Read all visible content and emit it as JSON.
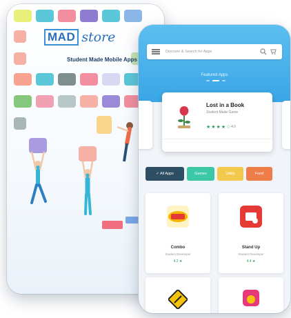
{
  "left_screen": {
    "logo_box": "MAD",
    "logo_script": "store",
    "tagline": "Student Made Mobile Apps"
  },
  "right_screen": {
    "search_placeholder": "Discover & Search for Apps",
    "header_title": "Featured Apps",
    "featured": {
      "title": "Lost in a Book",
      "subtitle": "Student Made Game",
      "stars": "★★★★☆",
      "rating": "4.0"
    },
    "filter_chips": [
      {
        "label": "✓ All Apps",
        "color": "#2e4f63"
      },
      {
        "label": "Games",
        "color": "#3cc8a6"
      },
      {
        "label": "Utility",
        "color": "#f2c94c"
      },
      {
        "label": "Food",
        "color": "#ef7d4a"
      }
    ],
    "apps": [
      {
        "name": "Combo",
        "developer": "Student Developer",
        "rating": "4.2 ★"
      },
      {
        "name": "Stand Up",
        "developer": "Student Developer",
        "rating": "4.4 ★"
      }
    ]
  },
  "colors": {
    "brand_blue": "#3aa6e6",
    "rating_green": "#2e9b5b"
  }
}
